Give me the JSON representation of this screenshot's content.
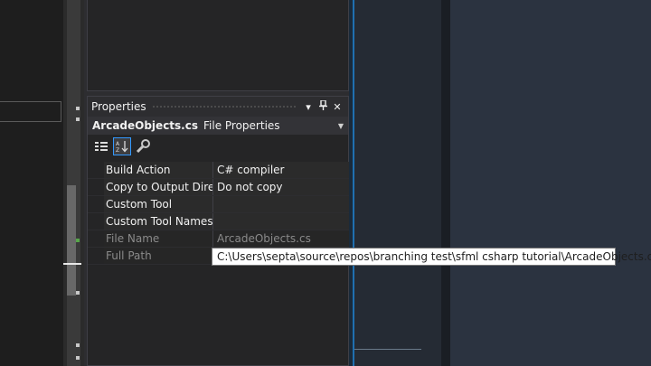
{
  "properties_panel": {
    "title": "Properties",
    "title_buttons": {
      "dropdown": "▾",
      "pin": "📌",
      "close": "✕"
    },
    "object": {
      "name": "ArcadeObjects.cs",
      "type": "File Properties"
    },
    "rows": [
      {
        "name": "Build Action",
        "value": "C# compiler",
        "readonly": false
      },
      {
        "name": "Copy to Output Directo",
        "value": "Do not copy",
        "readonly": false
      },
      {
        "name": "Custom Tool",
        "value": "",
        "readonly": false
      },
      {
        "name": "Custom Tool Namespa",
        "value": "",
        "readonly": false
      },
      {
        "name": "File Name",
        "value": "ArcadeObjects.cs",
        "readonly": true
      },
      {
        "name": "Full Path",
        "value": "",
        "readonly": true
      }
    ],
    "tooltip": "C:\\Users\\septa\\source\\repos\\branching test\\sfml csharp tutorial\\ArcadeObjects.cs"
  },
  "icons": {
    "categorized": "categorized-icon",
    "alphabetical": "alphabetical-icon",
    "property_pages": "wrench-icon"
  }
}
